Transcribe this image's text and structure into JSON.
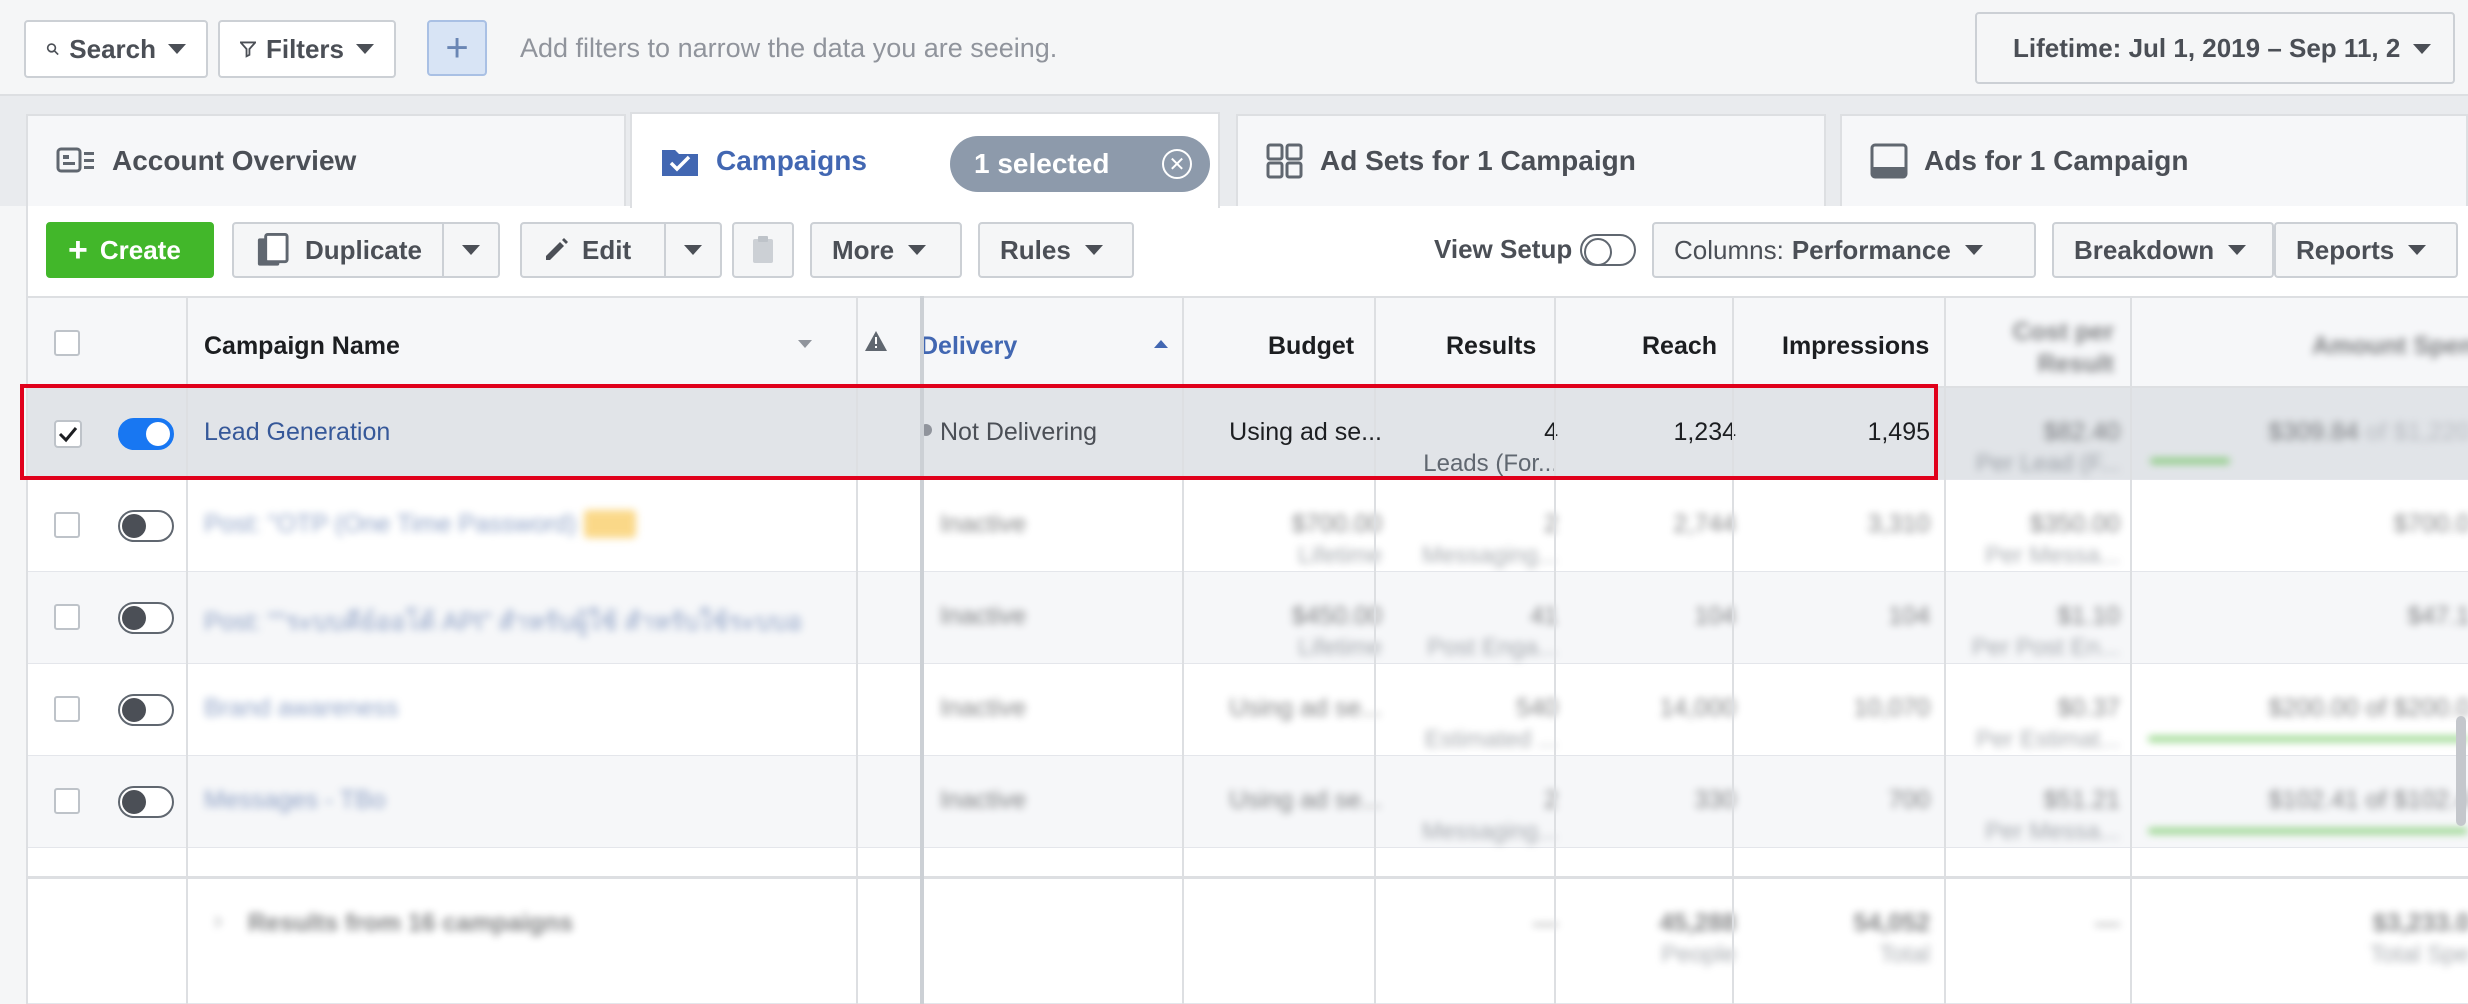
{
  "topbar": {
    "search_label": "Search",
    "filters_label": "Filters",
    "add_filter_symbol": "+",
    "filter_hint": "Add filters to narrow the data you are seeing.",
    "date_range": "Lifetime: Jul 1, 2019 – Sep 11, 2"
  },
  "tabs": {
    "account_overview": "Account Overview",
    "campaigns": "Campaigns",
    "selected_count": "1 selected",
    "ad_sets": "Ad Sets for 1 Campaign",
    "ads": "Ads for 1 Campaign"
  },
  "toolbar": {
    "create": "Create",
    "duplicate": "Duplicate",
    "edit": "Edit",
    "more": "More",
    "rules": "Rules",
    "view_setup": "View Setup",
    "columns_prefix": "Columns:",
    "columns_value": "Performance",
    "breakdown": "Breakdown",
    "reports": "Reports"
  },
  "table": {
    "headers": {
      "campaign_name": "Campaign Name",
      "delivery": "Delivery",
      "budget": "Budget",
      "results": "Results",
      "reach": "Reach",
      "impressions": "Impressions",
      "cost_per_result": "Cost per Result",
      "amount_spent": "Amount Spent"
    },
    "rows": [
      {
        "name": "Lead Generation",
        "delivery": "Not Delivering",
        "budget": "Using ad se...",
        "results": "4",
        "results_sub": "Leads (For...",
        "reach": "1,234",
        "impressions": "1,495",
        "cpr": "$82.40",
        "cpr_sub": "Per Lead (F...",
        "spent": "$309.84",
        "spent_sub": "of $1,220",
        "spent_progress": 0.25
      },
      {
        "name": "Post: \"OTP (One Time Password) \"",
        "delivery": "Inactive",
        "budget": "$700.00",
        "budget_sub": "Lifetime",
        "results": "2",
        "results_sub": "Messaging...",
        "reach": "2,744",
        "impressions": "3,310",
        "cpr": "$350.00",
        "cpr_sub": "Per Messa...",
        "spent": "$700.0"
      },
      {
        "name": "Post: \"\"ระบบคีย์ออโต้ API\" สำหรับผู้ใช้ สำหรับใช้ระบบออ...",
        "delivery": "Inactive",
        "budget": "$450.00",
        "budget_sub": "Lifetime",
        "results": "41",
        "results_sub": "Post Enga...",
        "reach": "104",
        "impressions": "104",
        "cpr": "$1.10",
        "cpr_sub": "Per Post En...",
        "spent": "$47.1"
      },
      {
        "name": "Brand awareness",
        "delivery": "Inactive",
        "budget": "Using ad se...",
        "results": "540",
        "results_sub": "Estimated ...",
        "reach": "14,000",
        "impressions": "10,070",
        "cpr": "$0.37",
        "cpr_sub": "Per Estimat...",
        "spent": "$200.00",
        "spent_sub": "of $200.0",
        "spent_progress": 1.0
      },
      {
        "name": "Messages - TBo",
        "delivery": "Inactive",
        "budget": "Using ad se...",
        "results": "2",
        "results_sub": "Messaging...",
        "reach": "330",
        "impressions": "700",
        "cpr": "$51.21",
        "cpr_sub": "Per Messa...",
        "spent": "$102.41",
        "spent_sub": "of $102.4",
        "spent_progress": 1.0
      }
    ],
    "footer": {
      "label": "Results from 16 campaigns",
      "results": "—",
      "reach": "45,288",
      "reach_sub": "People",
      "impressions": "54,052",
      "impressions_sub": "Total",
      "cpr": "—",
      "spent": "$3,233.0",
      "spent_sub": "Total Spe"
    }
  },
  "colors": {
    "accent_blue": "#4267b2",
    "create_green": "#42b72a",
    "highlight_red": "#e0001b",
    "selected_pill": "#8d9aab"
  }
}
